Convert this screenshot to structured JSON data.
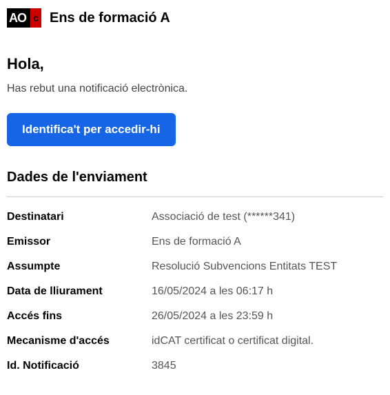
{
  "header": {
    "logo_main": "AO",
    "logo_accent": "c",
    "title": "Ens de formació A"
  },
  "greeting": "Hola,",
  "intro": "Has rebut una notificació electrònica.",
  "cta_label": "Identifica't per accedir-hi",
  "section_title": "Dades de l'enviament",
  "fields": {
    "recipient": {
      "label": "Destinatari",
      "value": "Associació de test (******341)"
    },
    "issuer": {
      "label": "Emissor",
      "value": "Ens de formació A"
    },
    "subject": {
      "label": "Assumpte",
      "value": "Resolució Subvencions Entitats TEST"
    },
    "delivery_date": {
      "label": "Data de lliurament",
      "value": "16/05/2024 a les 06:17 h"
    },
    "access_until": {
      "label": "Accés fins",
      "value": "26/05/2024 a les 23:59 h"
    },
    "access_mechanism": {
      "label": "Mecanisme d'accés",
      "value": "idCAT certificat o certificat digital."
    },
    "notification_id": {
      "label": "Id. Notificació",
      "value": "3845"
    }
  }
}
